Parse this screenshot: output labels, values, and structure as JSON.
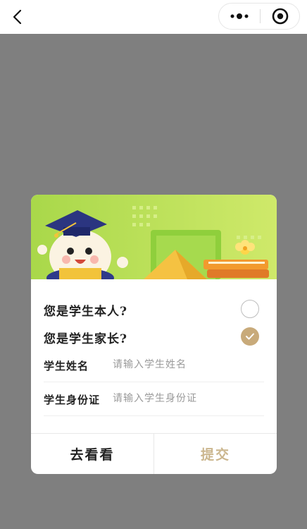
{
  "navbar": {
    "back_icon": "chevron-left-icon",
    "more_icon": "more-dots-icon",
    "close_icon": "target-close-icon"
  },
  "dialog": {
    "options": [
      {
        "label": "您是学生本人?",
        "checked": false
      },
      {
        "label": "您是学生家长?",
        "checked": true
      }
    ],
    "fields": [
      {
        "label": "学生姓名",
        "placeholder": "请输入学生姓名",
        "value": ""
      },
      {
        "label": "学生身份证",
        "placeholder": "请输入学生身份证",
        "value": ""
      }
    ],
    "buttons": {
      "left_label": "去看看",
      "right_label": "提交"
    }
  },
  "colors": {
    "accent": "#c8aa7a",
    "submit_text": "#cbb68e",
    "overlay": "#7f7f7f",
    "banner_green": "#b7df4a"
  }
}
